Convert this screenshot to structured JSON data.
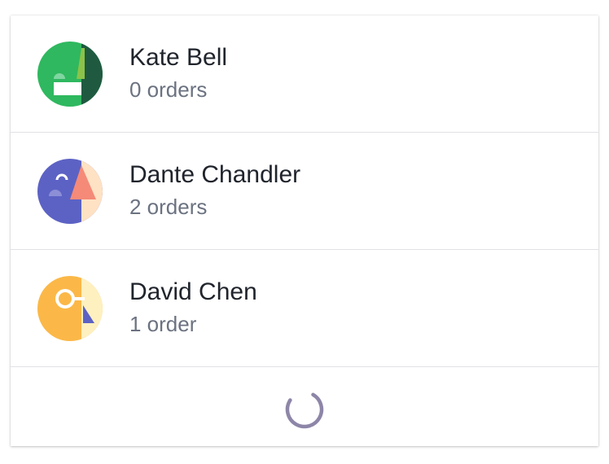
{
  "customers": [
    {
      "name": "Kate Bell",
      "orders": "0 orders",
      "avatar_icon": "abstract-face-green-icon"
    },
    {
      "name": "Dante Chandler",
      "orders": "2 orders",
      "avatar_icon": "abstract-face-purple-icon"
    },
    {
      "name": "David Chen",
      "orders": "1 order",
      "avatar_icon": "abstract-face-yellow-icon"
    }
  ],
  "colors": {
    "text_primary": "#20242c",
    "text_secondary": "#6b7280",
    "divider": "#dfe1e5",
    "spinner": "#8e86a8"
  },
  "loading_icon": "loading-spinner-icon"
}
